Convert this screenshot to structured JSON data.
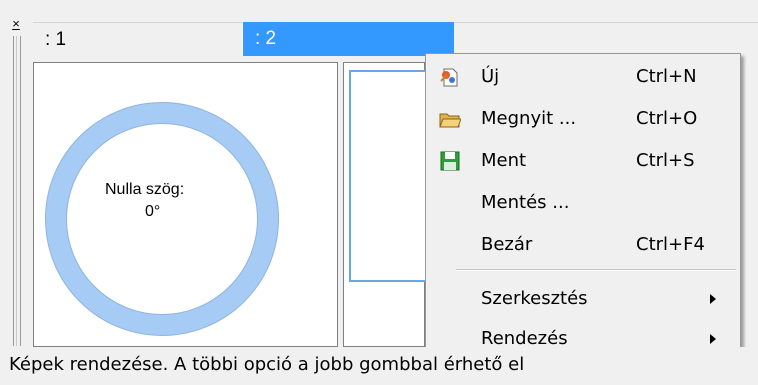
{
  "window": {
    "close_glyph": "×"
  },
  "tabs": [
    {
      "label": ": 1",
      "selected": false
    },
    {
      "label": ": 2",
      "selected": true
    }
  ],
  "panel1": {
    "ring_color": "#a6cbf5",
    "ring_stroke_color": "#8fb4de",
    "caption": "Nulla szög:",
    "angle_value": "0°"
  },
  "context_menu": {
    "items": [
      {
        "label": "Új",
        "shortcut": "Ctrl+N",
        "icon": "new-document-icon"
      },
      {
        "label": "Megnyit ...",
        "shortcut": "Ctrl+O",
        "icon": "open-folder-icon"
      },
      {
        "label": "Ment",
        "shortcut": "Ctrl+S",
        "icon": "save-floppy-icon"
      },
      {
        "label": "Mentés ...",
        "shortcut": "",
        "icon": ""
      },
      {
        "label": "Bezár",
        "shortcut": "Ctrl+F4",
        "icon": ""
      },
      {
        "label": "Szerkesztés",
        "shortcut": "",
        "icon": "",
        "submenu": true
      },
      {
        "label": "Rendezés",
        "shortcut": "",
        "icon": "",
        "submenu": true
      }
    ]
  },
  "status_bar": {
    "text": "Képek rendezése. A többi opció a jobb gombbal érhető el"
  },
  "colors": {
    "tab_selected": "#3399ff",
    "panel_border_selected": "#6aa7e6",
    "background": "#f0f0f0"
  }
}
